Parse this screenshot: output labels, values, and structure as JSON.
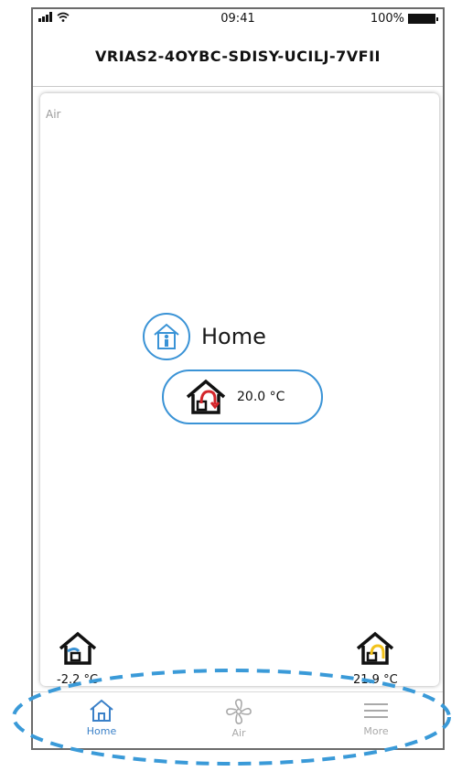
{
  "status_bar": {
    "time": "09:41",
    "battery": "100%"
  },
  "device_title": "VRIAS2-4OYBC-SDISY-UCILJ-7VFII",
  "card": {
    "label": "Air"
  },
  "mode": {
    "label": "Home",
    "icon": "home-person-icon"
  },
  "setpoint": {
    "value": "20.0 °C",
    "icon": "house-heating-icon"
  },
  "sensors": {
    "outdoor": {
      "value": "-2.2 °C",
      "icon": "house-outdoor-air-icon"
    },
    "exhaust": {
      "value": "21.9 °C",
      "icon": "house-exhaust-air-icon"
    }
  },
  "tabs": [
    {
      "label": "Home",
      "icon": "home-icon",
      "active": true
    },
    {
      "label": "Air",
      "icon": "fan-icon",
      "active": false
    },
    {
      "label": "More",
      "icon": "menu-icon",
      "active": false
    }
  ],
  "colors": {
    "accent": "#3a93d6",
    "active_tab": "#3a80c8",
    "inactive_tab": "#a9a9a9",
    "highlight_dashes": "#3a9ad8",
    "heat_red": "#d4262b",
    "exhaust_yellow": "#f2c21b"
  }
}
